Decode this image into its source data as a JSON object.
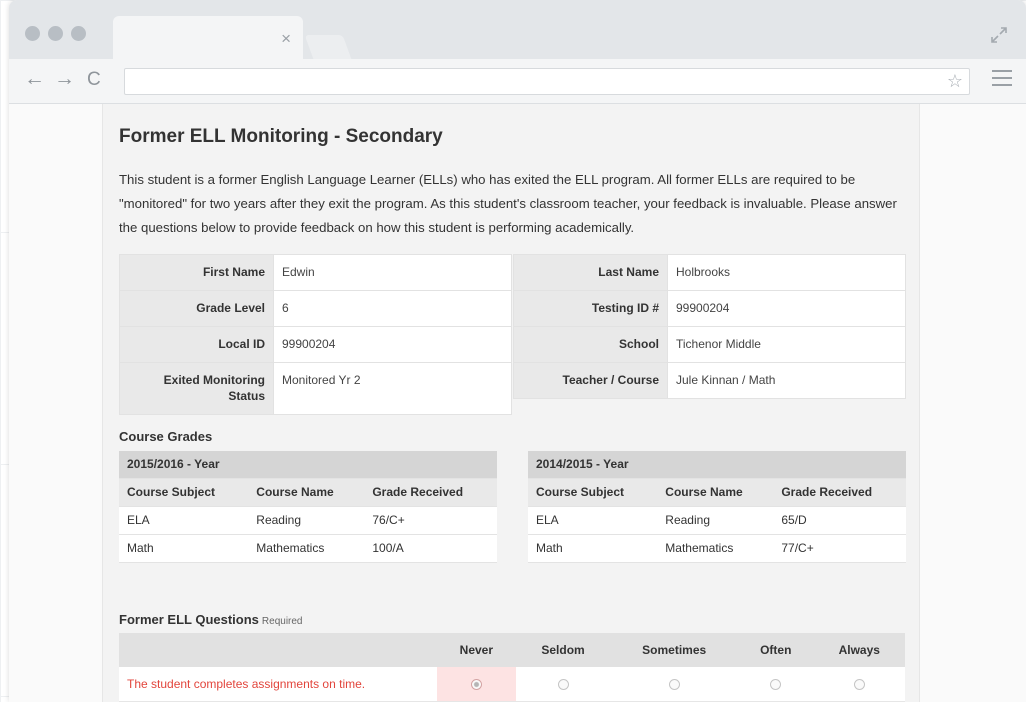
{
  "browser": {
    "tab_close": "×",
    "nav": {
      "back": "←",
      "forward": "→",
      "reload": "C"
    },
    "address_value": "",
    "star": "☆"
  },
  "page": {
    "title": "Former ELL Monitoring - Secondary",
    "intro": "This student is a former English Language Learner (ELLs) who has exited the ELL program. All former ELLs are required to be \"monitored\" for two years after they exit the program. As this student's classroom teacher, your feedback is invaluable. Please answer the questions below to provide feedback on how this student is performing academically."
  },
  "student": {
    "left": [
      {
        "label": "First Name",
        "value": "Edwin"
      },
      {
        "label": "Grade Level",
        "value": "6"
      },
      {
        "label": "Local ID",
        "value": "99900204"
      },
      {
        "label": "Exited Monitoring Status",
        "value": "Monitored Yr 2"
      }
    ],
    "right": [
      {
        "label": "Last Name",
        "value": "Holbrooks"
      },
      {
        "label": "Testing ID #",
        "value": "99900204"
      },
      {
        "label": "School",
        "value": "Tichenor Middle"
      },
      {
        "label": "Teacher / Course",
        "value": "Jule Kinnan / Math"
      }
    ]
  },
  "course_grades": {
    "title": "Course Grades",
    "columns": [
      "Course Subject",
      "Course Name",
      "Grade Received"
    ],
    "tables": [
      {
        "year": "2015/2016 - Year",
        "rows": [
          [
            "ELA",
            "Reading",
            "76/C+"
          ],
          [
            "Math",
            "Mathematics",
            "100/A"
          ]
        ]
      },
      {
        "year": "2014/2015 - Year",
        "rows": [
          [
            "ELA",
            "Reading",
            "65/D"
          ],
          [
            "Math",
            "Mathematics",
            "77/C+"
          ]
        ]
      }
    ]
  },
  "questions": {
    "title": "Former ELL Questions",
    "required": "Required",
    "options": [
      "Never",
      "Seldom",
      "Sometimes",
      "Often",
      "Always"
    ],
    "items": [
      {
        "text": "The student completes assignments on time.",
        "selected": "Never"
      }
    ]
  },
  "colors": {
    "error_text": "#e2453c",
    "selected_cell": "#fde3e3",
    "chrome": "#e3e6e9"
  }
}
